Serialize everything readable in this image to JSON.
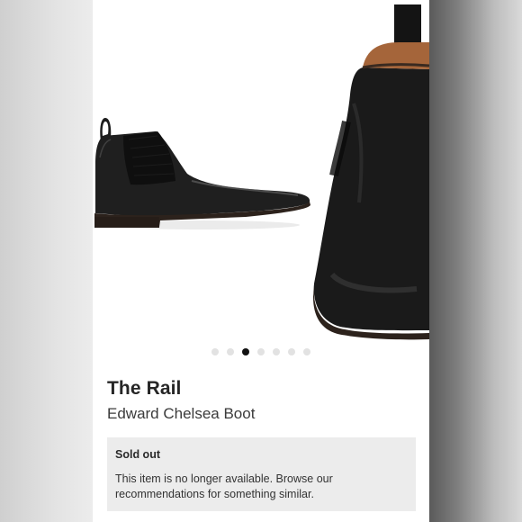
{
  "gallery": {
    "image_count": 7,
    "active_index": 2,
    "images": [
      {
        "alt_icon": "chelsea-boot-side-view"
      },
      {
        "alt_icon": "chelsea-boot-closeup"
      }
    ]
  },
  "product": {
    "brand": "The Rail",
    "name": "Edward Chelsea Boot"
  },
  "availability": {
    "title": "Sold out",
    "message": "This item is no longer available. Browse our recommendations for something similar."
  },
  "colors": {
    "leather": "#1c1c1c",
    "sole": "#2b211b",
    "lining": "#a5653a",
    "notice_bg": "#ececec",
    "active_dot": "#111111",
    "inactive_dot": "#e2e2e2"
  }
}
